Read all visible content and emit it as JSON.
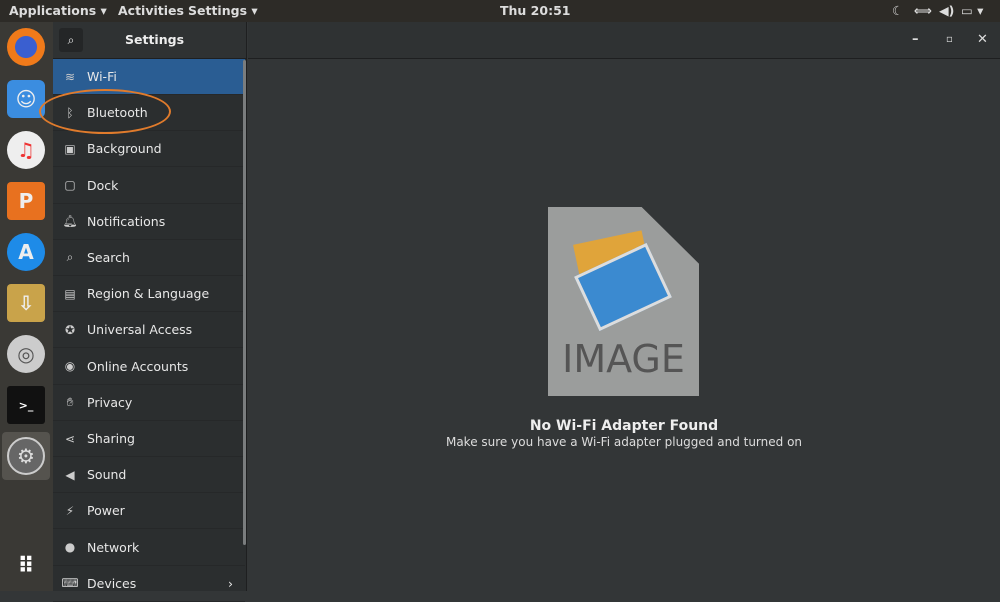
{
  "topbar": {
    "applications": "Applications ▾",
    "activities": "Activities",
    "app_menu": "Settings ▾",
    "clock": "Thu 20:51"
  },
  "dock": {
    "apps": [
      "Firefox",
      "Finder",
      "Music",
      "Presentation",
      "App Store",
      "Installer",
      "Help",
      "Terminal",
      "Settings",
      "Show Applications"
    ]
  },
  "sidebar": {
    "title": "Settings",
    "items": [
      {
        "label": "Wi-Fi",
        "icon": "wifi-icon"
      },
      {
        "label": "Bluetooth",
        "icon": "bluetooth-icon"
      },
      {
        "label": "Background",
        "icon": "background-icon"
      },
      {
        "label": "Dock",
        "icon": "dock-icon"
      },
      {
        "label": "Notifications",
        "icon": "bell-icon"
      },
      {
        "label": "Search",
        "icon": "search-icon"
      },
      {
        "label": "Region & Language",
        "icon": "region-icon"
      },
      {
        "label": "Universal Access",
        "icon": "accessibility-icon"
      },
      {
        "label": "Online Accounts",
        "icon": "accounts-icon"
      },
      {
        "label": "Privacy",
        "icon": "hand-icon"
      },
      {
        "label": "Sharing",
        "icon": "share-icon"
      },
      {
        "label": "Sound",
        "icon": "speaker-icon"
      },
      {
        "label": "Power",
        "icon": "power-icon"
      },
      {
        "label": "Network",
        "icon": "network-icon"
      },
      {
        "label": "Devices",
        "icon": "devices-icon"
      }
    ]
  },
  "main": {
    "image_text": "IMAGE",
    "title": "No Wi-Fi Adapter Found",
    "subtitle": "Make sure you have a Wi-Fi adapter plugged and turned on"
  },
  "colors": {
    "selected": "#2a5d93",
    "highlight": "#e07b2c"
  }
}
